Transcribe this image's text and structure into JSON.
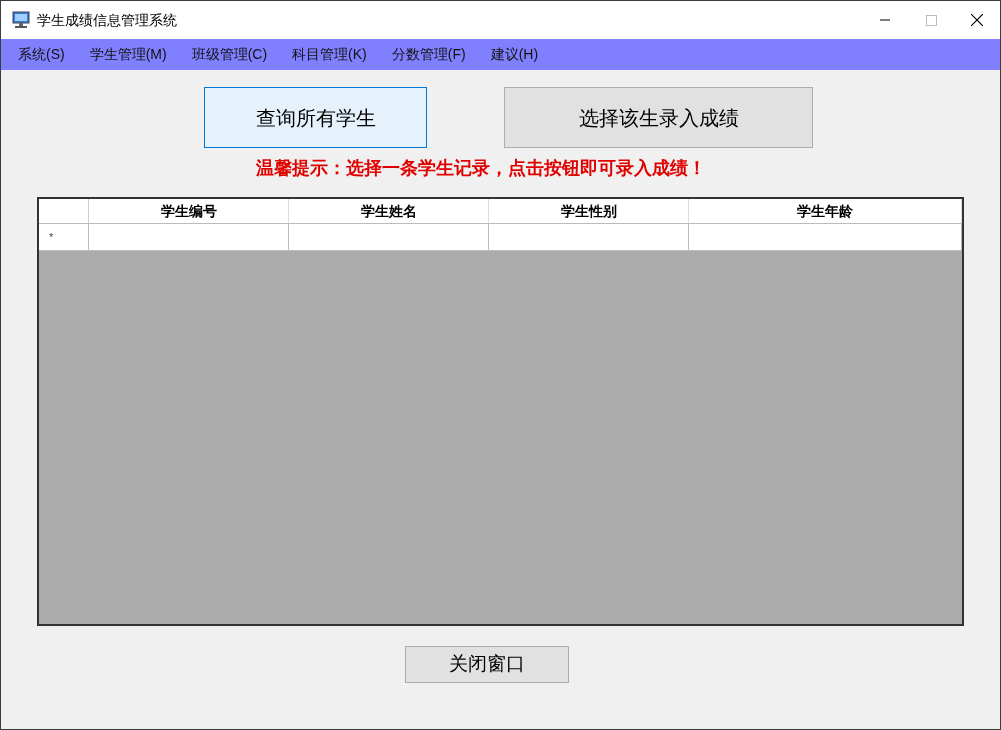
{
  "window": {
    "title": "学生成绩信息管理系统"
  },
  "menu": [
    "系统(S)",
    "学生管理(M)",
    "班级管理(C)",
    "科目管理(K)",
    "分数管理(F)",
    "建议(H)"
  ],
  "buttons": [
    {
      "label": "查询所有学生",
      "selected": true
    },
    {
      "label": "选择该生录入成绩",
      "selected": false
    }
  ],
  "hint": "温馨提示：选择一条学生记录，点击按钮即可录入成绩！",
  "table": {
    "columns": [
      "学生编号",
      "学生姓名",
      "学生性别",
      "学生年龄"
    ],
    "new_row_marker": "*"
  },
  "close_button": "关闭窗口"
}
